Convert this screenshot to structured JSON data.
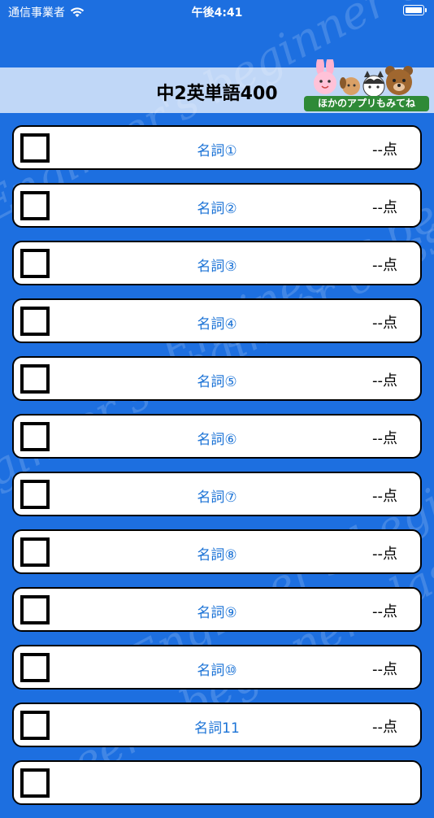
{
  "status_bar": {
    "carrier": "通信事業者",
    "time": "午後4:41"
  },
  "header": {
    "title": "中2英単語400",
    "promo_label": "ほかのアプリもみてね"
  },
  "rows": [
    {
      "label": "名詞①",
      "score": "--点"
    },
    {
      "label": "名詞②",
      "score": "--点"
    },
    {
      "label": "名詞③",
      "score": "--点"
    },
    {
      "label": "名詞④",
      "score": "--点"
    },
    {
      "label": "名詞⑤",
      "score": "--点"
    },
    {
      "label": "名詞⑥",
      "score": "--点"
    },
    {
      "label": "名詞⑦",
      "score": "--点"
    },
    {
      "label": "名詞⑧",
      "score": "--点"
    },
    {
      "label": "名詞⑨",
      "score": "--点"
    },
    {
      "label": "名詞⑩",
      "score": "--点"
    },
    {
      "label": "名詞11",
      "score": "--点"
    },
    {
      "label": "",
      "score": ""
    }
  ],
  "watermark_text": [
    "Engineer's beginner class"
  ],
  "colors": {
    "background": "#1d6fe0",
    "label": "#1a72d6",
    "promo": "#2f8a37"
  }
}
